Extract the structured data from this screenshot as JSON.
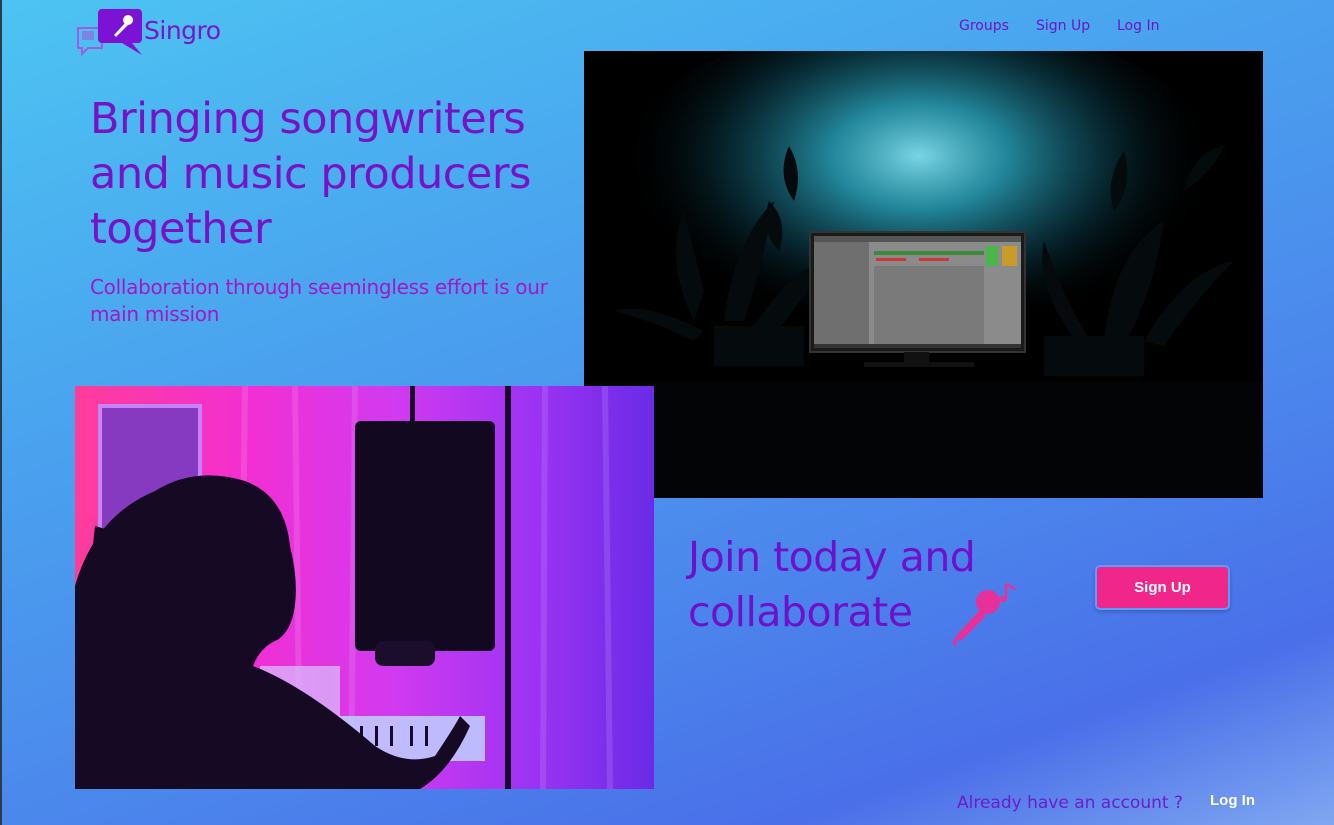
{
  "brand": {
    "name": "Singro",
    "primary_color": "#7613c7",
    "accent_color": "#f0268a",
    "logo_icon": "microphone-chat-bubble-icon"
  },
  "nav": {
    "groups": "Groups",
    "sign_up": "Sign Up",
    "log_in": "Log In"
  },
  "hero": {
    "title": "Bringing songwriters and music producers together",
    "subtitle": "Collaboration through seemingless effort is our main mission"
  },
  "images": {
    "studio": "studio-monitor-photo",
    "singer": "singer-silhouette-photo"
  },
  "join": {
    "title": "Join today and collaborate",
    "icon": "microphone-music-note-icon",
    "button_label": "Sign Up"
  },
  "footer": {
    "question": "Already have an account ?",
    "login_label": "Log In"
  }
}
